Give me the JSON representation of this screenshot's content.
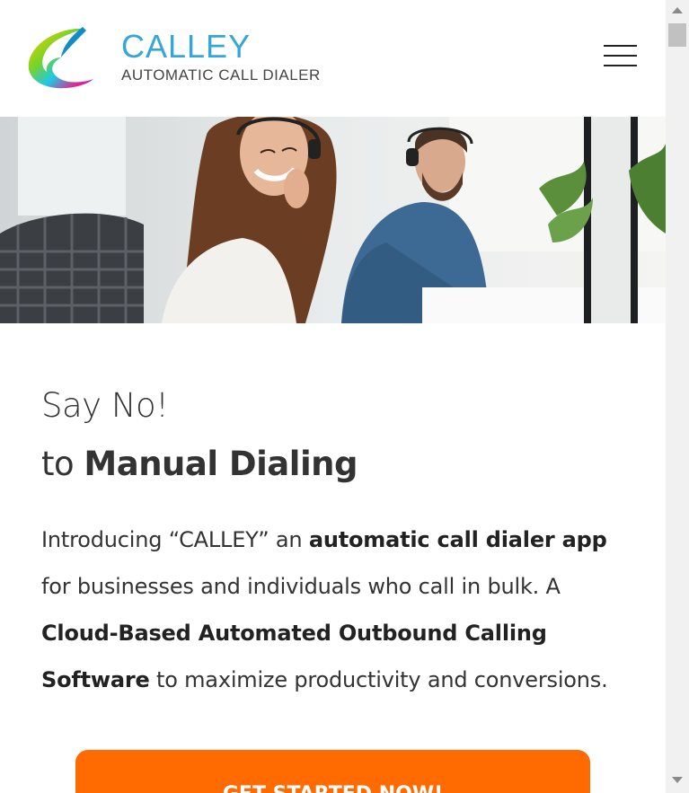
{
  "header": {
    "brand": "CALLEY",
    "tagline": "AUTOMATIC CALL DIALER",
    "logo_icon": "calley-swirl-logo-icon",
    "menu_icon": "hamburger-menu-icon"
  },
  "hero": {
    "image": "call-center-agents-photo"
  },
  "main": {
    "headline_line1": "Say No!",
    "headline_line2_prefix": "to ",
    "headline_line2_bold": "Manual Dialing",
    "intro": {
      "part1": "Introducing “CALLEY” an ",
      "bold1": "automatic call dialer app",
      "part2": " for businesses and individuals who call in bulk. A ",
      "bold2": "Cloud-Based Automated Outbound Calling Software",
      "part3": " to maximize productivity and conversions."
    },
    "cta_label": "GET STARTED NOW!"
  },
  "colors": {
    "brand_blue": "#34a7d8",
    "cta_orange": "#ff6b00",
    "text_dark": "#333333"
  }
}
